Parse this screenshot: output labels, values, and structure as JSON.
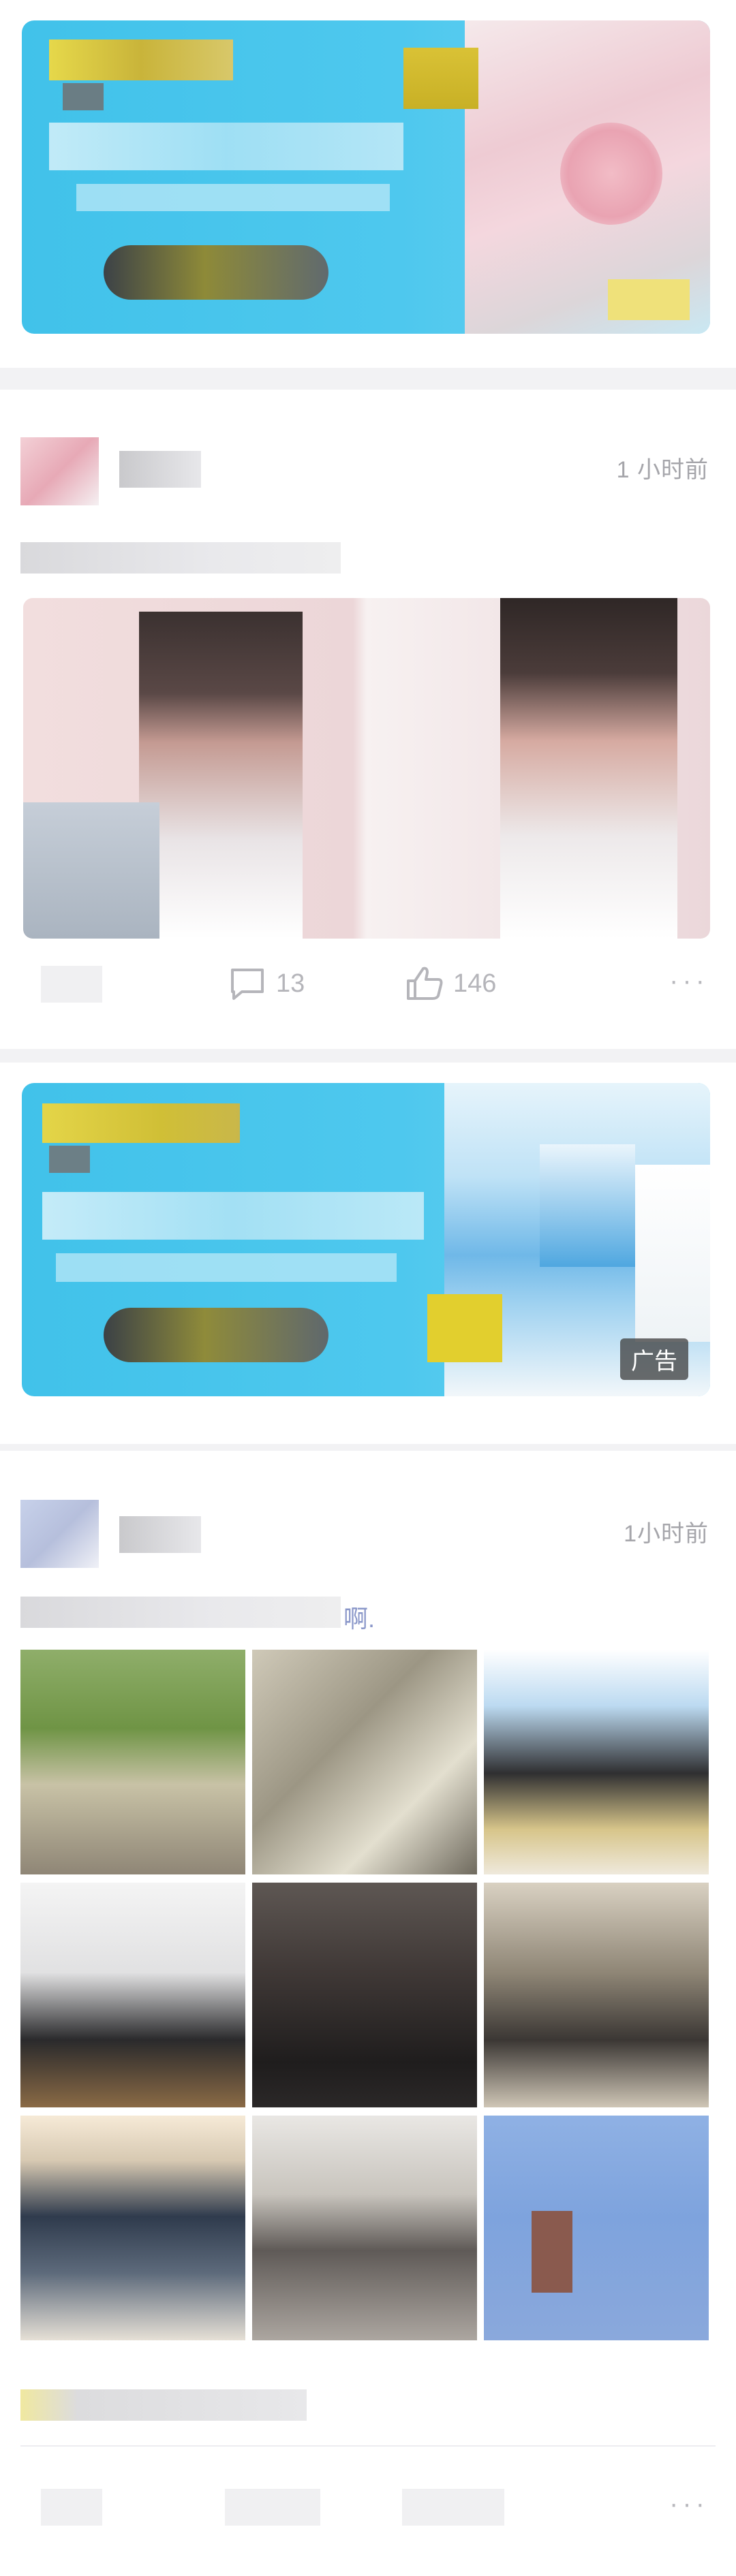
{
  "feed": {
    "ad1": {
      "label": ""
    },
    "post1": {
      "time": "1 小时前",
      "actions": {
        "comment_count": "13",
        "like_count": "146",
        "more": "···"
      }
    },
    "ad2": {
      "label": "广告"
    },
    "post2": {
      "time": "1小时前",
      "caption_tail": "啊.",
      "actions": {
        "more": "···"
      }
    }
  },
  "icons": [
    "comment-icon",
    "thumbs-up-icon",
    "more-icon"
  ],
  "colors": {
    "banner_blue": "#44c4ec",
    "background": "#f2f2f4",
    "muted_text": "#a5a5aa"
  }
}
